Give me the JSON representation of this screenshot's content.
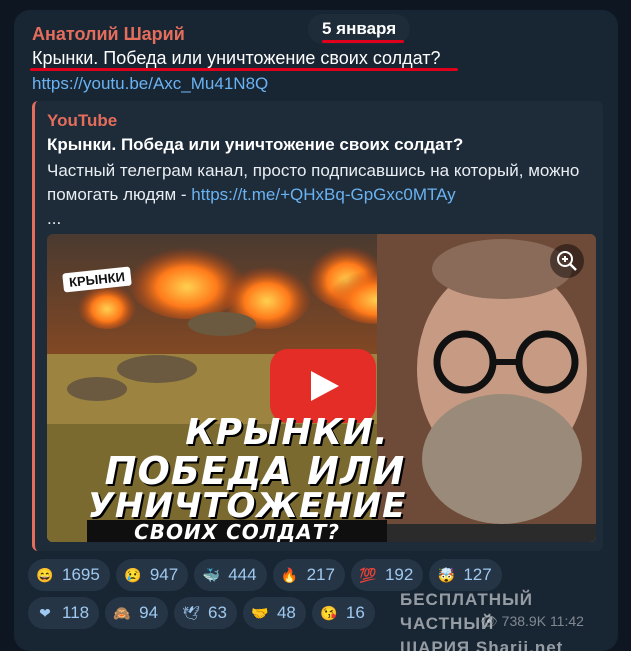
{
  "date_label": "5 января",
  "post": {
    "author": "Анатолий Шарий",
    "headline": "Крынки. Победа или уничтожение своих солдат?",
    "link": "https://youtu.be/Axc_Mu41N8Q"
  },
  "preview": {
    "site": "YouTube",
    "title": "Крынки. Победа или уничтожение своих солдат?",
    "desc_text": "Частный телеграм канал, просто подписавшись на который, можно помогать людям - ",
    "desc_link": "https://t.me/+QHxBq-GpGxc0MTAy",
    "desc_more": "...",
    "thumbnail": {
      "sign": "КРЫНКИ",
      "line1": "КРЫНКИ.",
      "line2": "ПОБЕДА ИЛИ",
      "line3": "УНИЧТОЖЕНИЕ",
      "line4": "СВОИХ СОЛДАТ?"
    }
  },
  "reactions": {
    "row1": [
      {
        "icon": "grinning-face-icon",
        "glyph": "😄",
        "count": "1695"
      },
      {
        "icon": "crying-face-icon",
        "glyph": "😢",
        "count": "947"
      },
      {
        "icon": "whale-icon",
        "glyph": "🐳",
        "count": "444"
      },
      {
        "icon": "fire-icon",
        "glyph": "🔥",
        "count": "217"
      },
      {
        "icon": "hundred-points-icon",
        "glyph": "💯",
        "count": "192"
      },
      {
        "icon": "exploding-head-icon",
        "glyph": "🤯",
        "count": "127"
      }
    ],
    "row2": [
      {
        "icon": "red-heart-icon",
        "glyph": "❤",
        "count": "118"
      },
      {
        "icon": "see-no-evil-monkey-icon",
        "glyph": "🙈",
        "count": "94"
      },
      {
        "icon": "dove-icon",
        "glyph": "🕊",
        "count": "63"
      },
      {
        "icon": "handshake-icon",
        "glyph": "🤝",
        "count": "48"
      },
      {
        "icon": "kissing-face-icon",
        "glyph": "😘",
        "count": "16"
      }
    ]
  },
  "watermark": {
    "line1": "БЕСПЛАТНЫЙ ЧАСТНЫЙ",
    "line2": "ШАРИЯ  Sharij.net"
  },
  "meta": {
    "views": "738.9K",
    "time": "11:42"
  },
  "colors": {
    "background": "#0e1621",
    "bubble": "#182533",
    "author": "#e56d5b",
    "link": "#6ab3f3",
    "highlight": "#e0001b",
    "play_button": "#e52d27"
  }
}
